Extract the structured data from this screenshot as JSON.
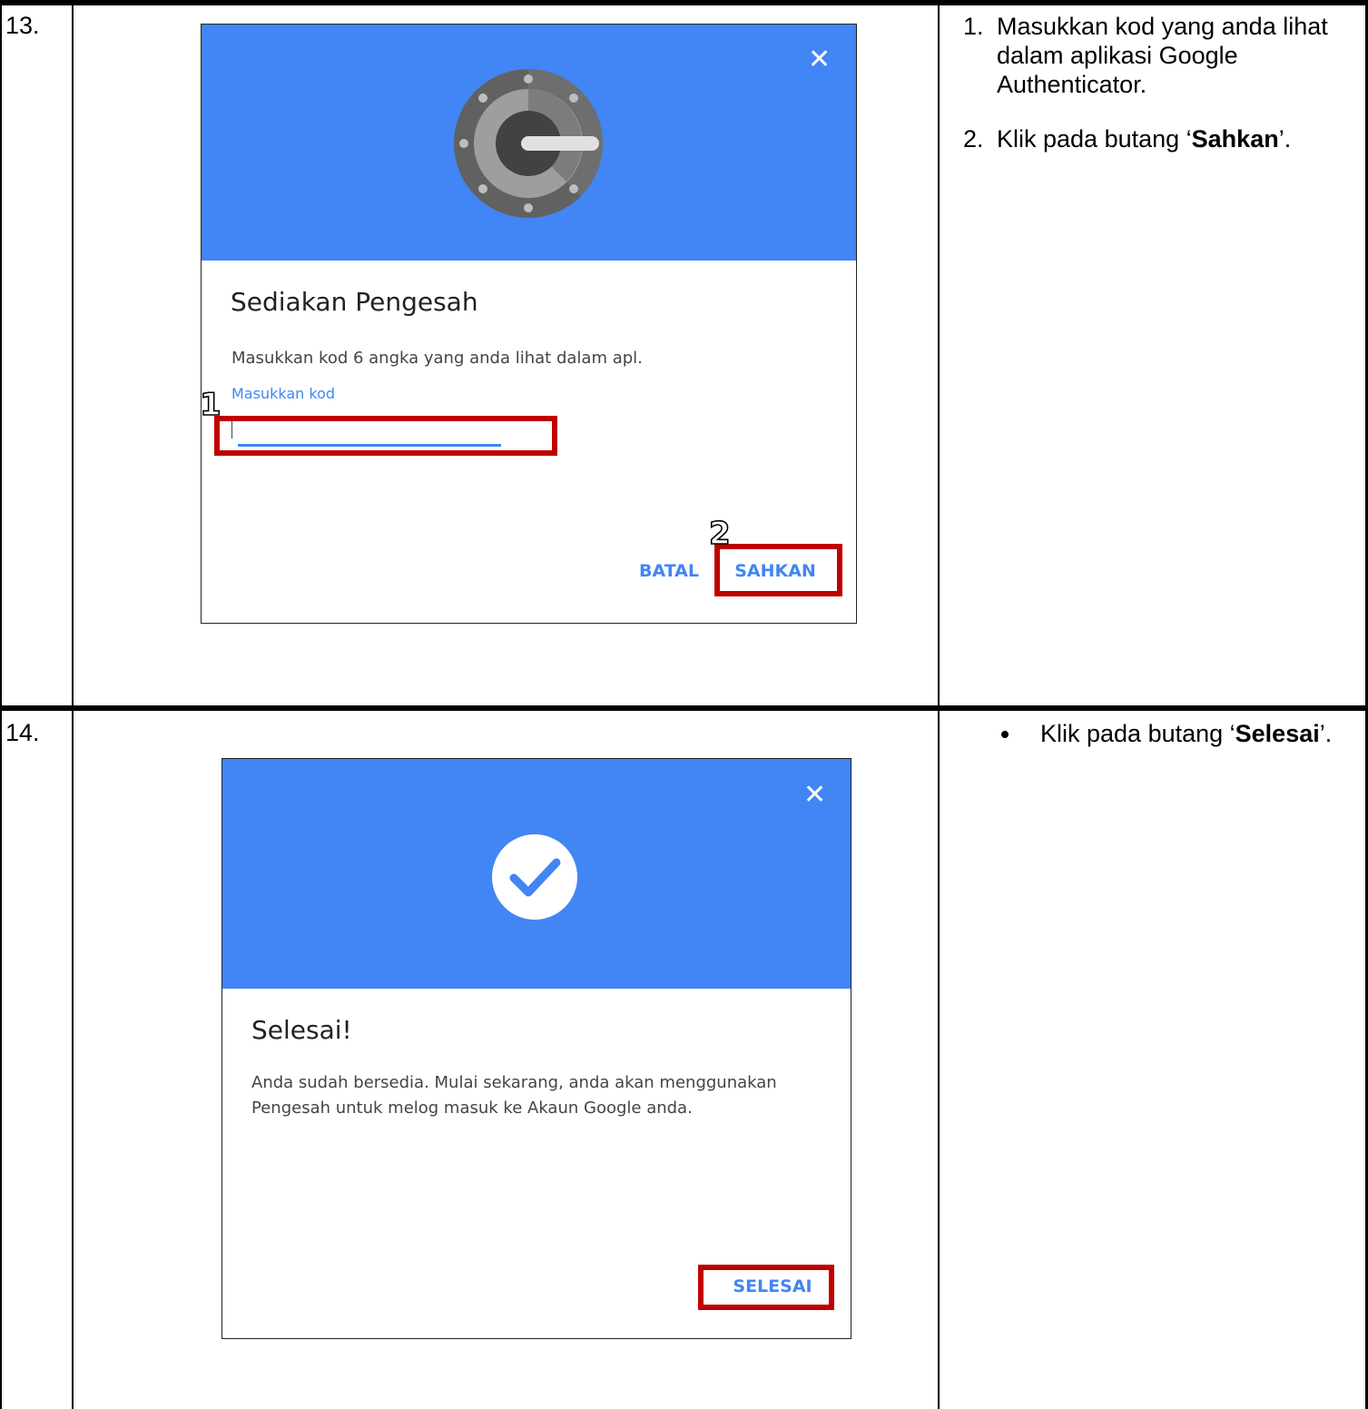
{
  "rows": [
    {
      "number": "13.",
      "dialog": {
        "title": "Sediakan Pengesah",
        "description": "Masukkan kod 6 angka yang anda lihat dalam apl.",
        "input_label": "Masukkan kod",
        "input_value": "",
        "cancel_label": "BATAL",
        "confirm_label": "SAHKAN",
        "close_icon": "close-icon",
        "header_icon": "google-authenticator-logo",
        "step_markers": [
          "1",
          "2"
        ]
      },
      "instructions": {
        "items": [
          {
            "num": "1.",
            "text": "Masukkan kod yang anda lihat dalam aplikasi Google Authenticator."
          },
          {
            "num": "2.",
            "prefix": "Klik pada butang ‘",
            "bold": "Sahkan",
            "suffix": "’."
          }
        ]
      }
    },
    {
      "number": "14.",
      "dialog": {
        "title": "Selesai!",
        "description": "Anda sudah bersedia. Mulai sekarang, anda akan menggunakan Pengesah untuk melog masuk ke Akaun Google anda.",
        "done_label": "SELESAI",
        "close_icon": "close-icon",
        "header_icon": "checkmark-circle-icon"
      },
      "instructions": {
        "items": [
          {
            "prefix": "Klik pada butang ‘",
            "bold": "Selesai",
            "suffix": "’."
          }
        ]
      }
    }
  ],
  "colors": {
    "header_blue": "#4285f4",
    "highlight_red": "#c00000",
    "link_blue": "#4285f4"
  }
}
